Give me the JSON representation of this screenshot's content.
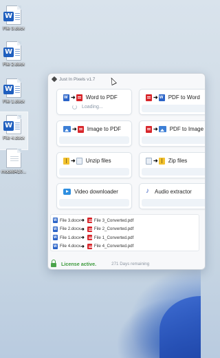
{
  "desktop": {
    "icons": [
      {
        "label": "File 3.docx",
        "type": "word"
      },
      {
        "label": "File 2.docx",
        "type": "word"
      },
      {
        "label": "File 1.docx",
        "type": "word"
      },
      {
        "label": "File 4.docx",
        "type": "word"
      },
      {
        "label": "mode8410...",
        "type": "blank"
      }
    ]
  },
  "window": {
    "title": "Just In Pixels v1.7",
    "tools": [
      {
        "label": "Word to PDF",
        "status": "Loading..."
      },
      {
        "label": "PDF to Word"
      },
      {
        "label": "Image to PDF"
      },
      {
        "label": "PDF to Image"
      },
      {
        "label": "Unzip files"
      },
      {
        "label": "Zip files"
      },
      {
        "label": "Video downloader"
      },
      {
        "label": "Audio extractor"
      }
    ],
    "conversions": [
      {
        "source": "File 3.docx",
        "target": "File 3_Converted.pdf"
      },
      {
        "source": "File 2.docx",
        "target": "File 2_Converted.pdf"
      },
      {
        "source": "File 1.docx",
        "target": "File 1_Converted.pdf"
      },
      {
        "source": "File 4.docx",
        "target": "File 4_Converted.pdf"
      }
    ],
    "status": {
      "license": "License active.",
      "days_remaining": "271 Days remaining"
    }
  },
  "colors": {
    "word_blue": "#2b64c8",
    "pdf_red": "#d8262b",
    "license_green": "#3d9a3d"
  }
}
